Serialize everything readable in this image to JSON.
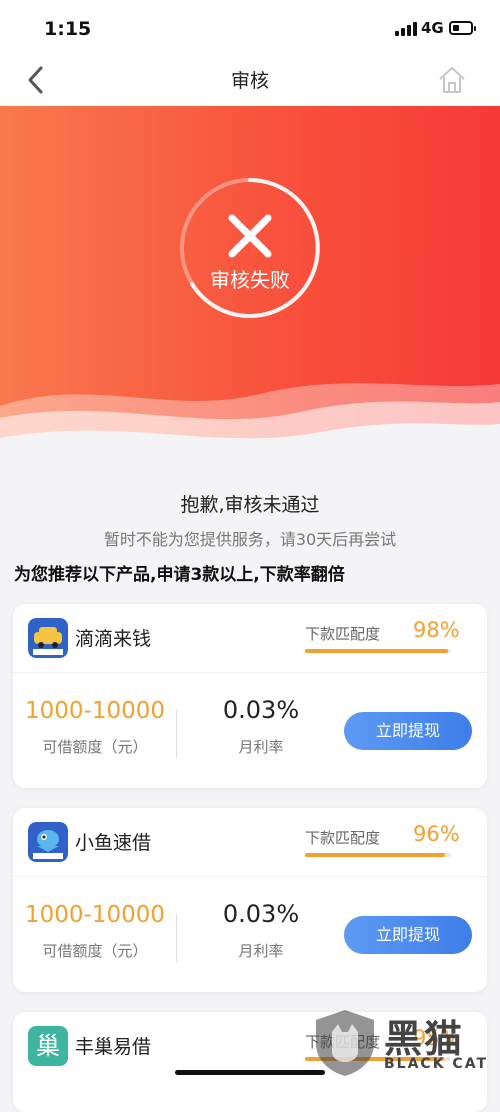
{
  "status": {
    "time": "1:15",
    "network": "4G"
  },
  "nav": {
    "title": "审核",
    "back_icon": "chevron-left-icon",
    "home_icon": "home-icon"
  },
  "result": {
    "status_text": "审核失败",
    "icon": "close-x-icon",
    "title": "抱歉,审核未通过",
    "subtitle": "暂时不能为您提供服务，请30天后再尝试"
  },
  "recommend_title": "为您推荐以下产品,申请3款以上,下款率翻倍",
  "products": [
    {
      "name": "滴滴来钱",
      "match_label": "下款匹配度",
      "match": "98%",
      "match_value": 0.98,
      "amount": "1000-10000",
      "amount_label": "可借额度（元）",
      "rate": "0.03%",
      "rate_label": "月利率",
      "apply_label": "立即提现",
      "icon": "car-app-icon",
      "icon_text": "滴滴来钱"
    },
    {
      "name": "小鱼速借",
      "match_label": "下款匹配度",
      "match": "96%",
      "match_value": 0.96,
      "amount": "1000-10000",
      "amount_label": "可借额度（元）",
      "rate": "0.03%",
      "rate_label": "月利率",
      "apply_label": "立即提现",
      "icon": "fish-app-icon",
      "icon_text": "小鱼速借"
    },
    {
      "name": "丰巢易借",
      "match_label": "下款匹配度",
      "match": "95%",
      "match_value": 0.95,
      "icon": "nest-app-icon",
      "icon_text": "巢"
    }
  ],
  "watermark": {
    "text": "黑猫",
    "sub": "BLACK CAT"
  },
  "colors": {
    "hero_start": "#f9794f",
    "hero_end": "#f63a37",
    "accent_orange": "#f3a033",
    "button_blue": "#3f7de9"
  }
}
